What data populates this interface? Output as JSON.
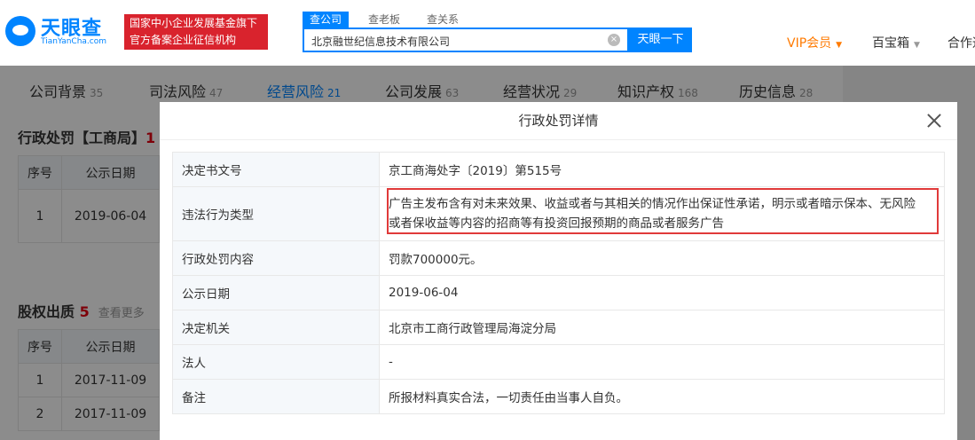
{
  "header": {
    "logo_text": "天眼查",
    "logo_sub": "TianYanCha.com",
    "badge_line1": "国家中小企业发展基金旗下",
    "badge_line2": "官方备案企业征信机构",
    "search_tabs": [
      "查公司",
      "查老板",
      "查关系"
    ],
    "search_value": "北京融世纪信息技术有限公司",
    "search_button": "天眼一下",
    "vip_label": "VIP会员",
    "toolbox_label": "百宝箱",
    "coop_label": "合作通"
  },
  "nav": {
    "items": [
      {
        "label": "公司背景",
        "count": "35"
      },
      {
        "label": "司法风险",
        "count": "47"
      },
      {
        "label": "经营风险",
        "count": "21"
      },
      {
        "label": "公司发展",
        "count": "63"
      },
      {
        "label": "经营状况",
        "count": "29"
      },
      {
        "label": "知识产权",
        "count": "168"
      },
      {
        "label": "历史信息",
        "count": "28"
      }
    ]
  },
  "section1": {
    "title": "行政处罚【工商局】",
    "count": "1",
    "headers": [
      "序号",
      "公示日期"
    ],
    "rows": [
      [
        "1",
        "2019-06-04"
      ]
    ]
  },
  "section2": {
    "title": "股权出质",
    "count": "5",
    "see_more": "查看更多",
    "headers": [
      "序号",
      "公示日期"
    ],
    "rows": [
      [
        "1",
        "2017-11-09"
      ],
      [
        "2",
        "2017-11-09"
      ]
    ]
  },
  "modal": {
    "title": "行政处罚详情",
    "rows": [
      {
        "label": "决定书文号",
        "value": "京工商海处字〔2019〕第515号"
      },
      {
        "label": "违法行为类型",
        "value": "广告主发布含有对未来效果、收益或者与其相关的情况作出保证性承诺，明示或者暗示保本、无风险或者保收益等内容的招商等有投资回报预期的商品或者服务广告"
      },
      {
        "label": "行政处罚内容",
        "value": "罚款700000元。"
      },
      {
        "label": "公示日期",
        "value": "2019-06-04"
      },
      {
        "label": "决定机关",
        "value": "北京市工商行政管理局海淀分局"
      },
      {
        "label": "法人",
        "value": "-"
      },
      {
        "label": "备注",
        "value": "所报材料真实合法，一切责任由当事人自负。"
      }
    ]
  },
  "colors": {
    "accent": "#0084ff",
    "badge": "#d9232d",
    "highlight": "#e03a3a",
    "vip": "#ff7a00"
  }
}
